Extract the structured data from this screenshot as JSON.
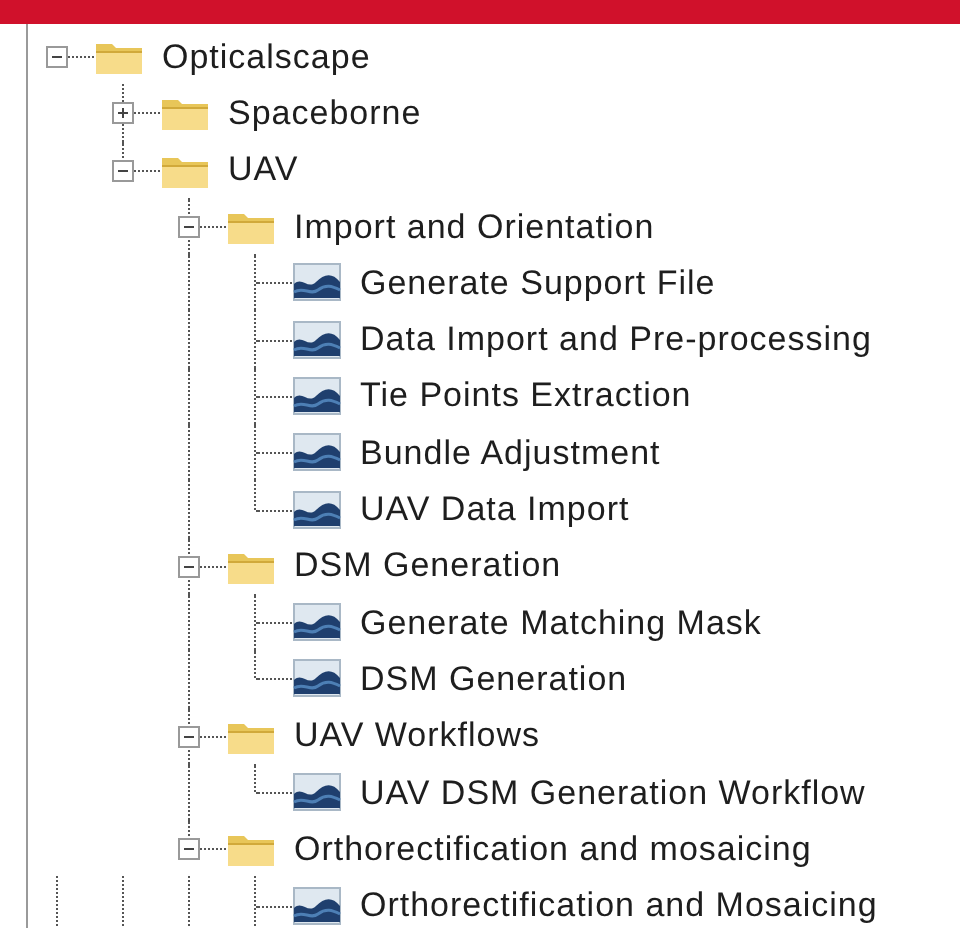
{
  "tree": {
    "continues_below": true,
    "nodes": [
      {
        "label": "Opticalscape",
        "kind": "folder",
        "expanded": true,
        "children": [
          {
            "label": "Spaceborne",
            "kind": "folder",
            "expanded": false
          },
          {
            "label": "UAV",
            "kind": "folder",
            "expanded": true,
            "children": [
              {
                "label": "Import and Orientation",
                "kind": "folder",
                "expanded": true,
                "children": [
                  {
                    "label": "Generate Support File",
                    "kind": "tool"
                  },
                  {
                    "label": "Data Import and Pre-processing",
                    "kind": "tool"
                  },
                  {
                    "label": "Tie Points Extraction",
                    "kind": "tool"
                  },
                  {
                    "label": "Bundle Adjustment",
                    "kind": "tool"
                  },
                  {
                    "label": "UAV Data Import",
                    "kind": "tool"
                  }
                ]
              },
              {
                "label": "DSM Generation",
                "kind": "folder",
                "expanded": true,
                "children": [
                  {
                    "label": "Generate Matching Mask",
                    "kind": "tool"
                  },
                  {
                    "label": "DSM Generation",
                    "kind": "tool"
                  }
                ]
              },
              {
                "label": "UAV Workflows",
                "kind": "folder",
                "expanded": true,
                "children": [
                  {
                    "label": "UAV DSM Generation Workflow",
                    "kind": "tool"
                  }
                ]
              },
              {
                "label": "Orthorectification and mosaicing",
                "kind": "folder",
                "expanded": true,
                "children": [
                  {
                    "label": "Orthorectification and Mosaicing",
                    "kind": "tool"
                  }
                ]
              }
            ]
          }
        ]
      }
    ]
  }
}
